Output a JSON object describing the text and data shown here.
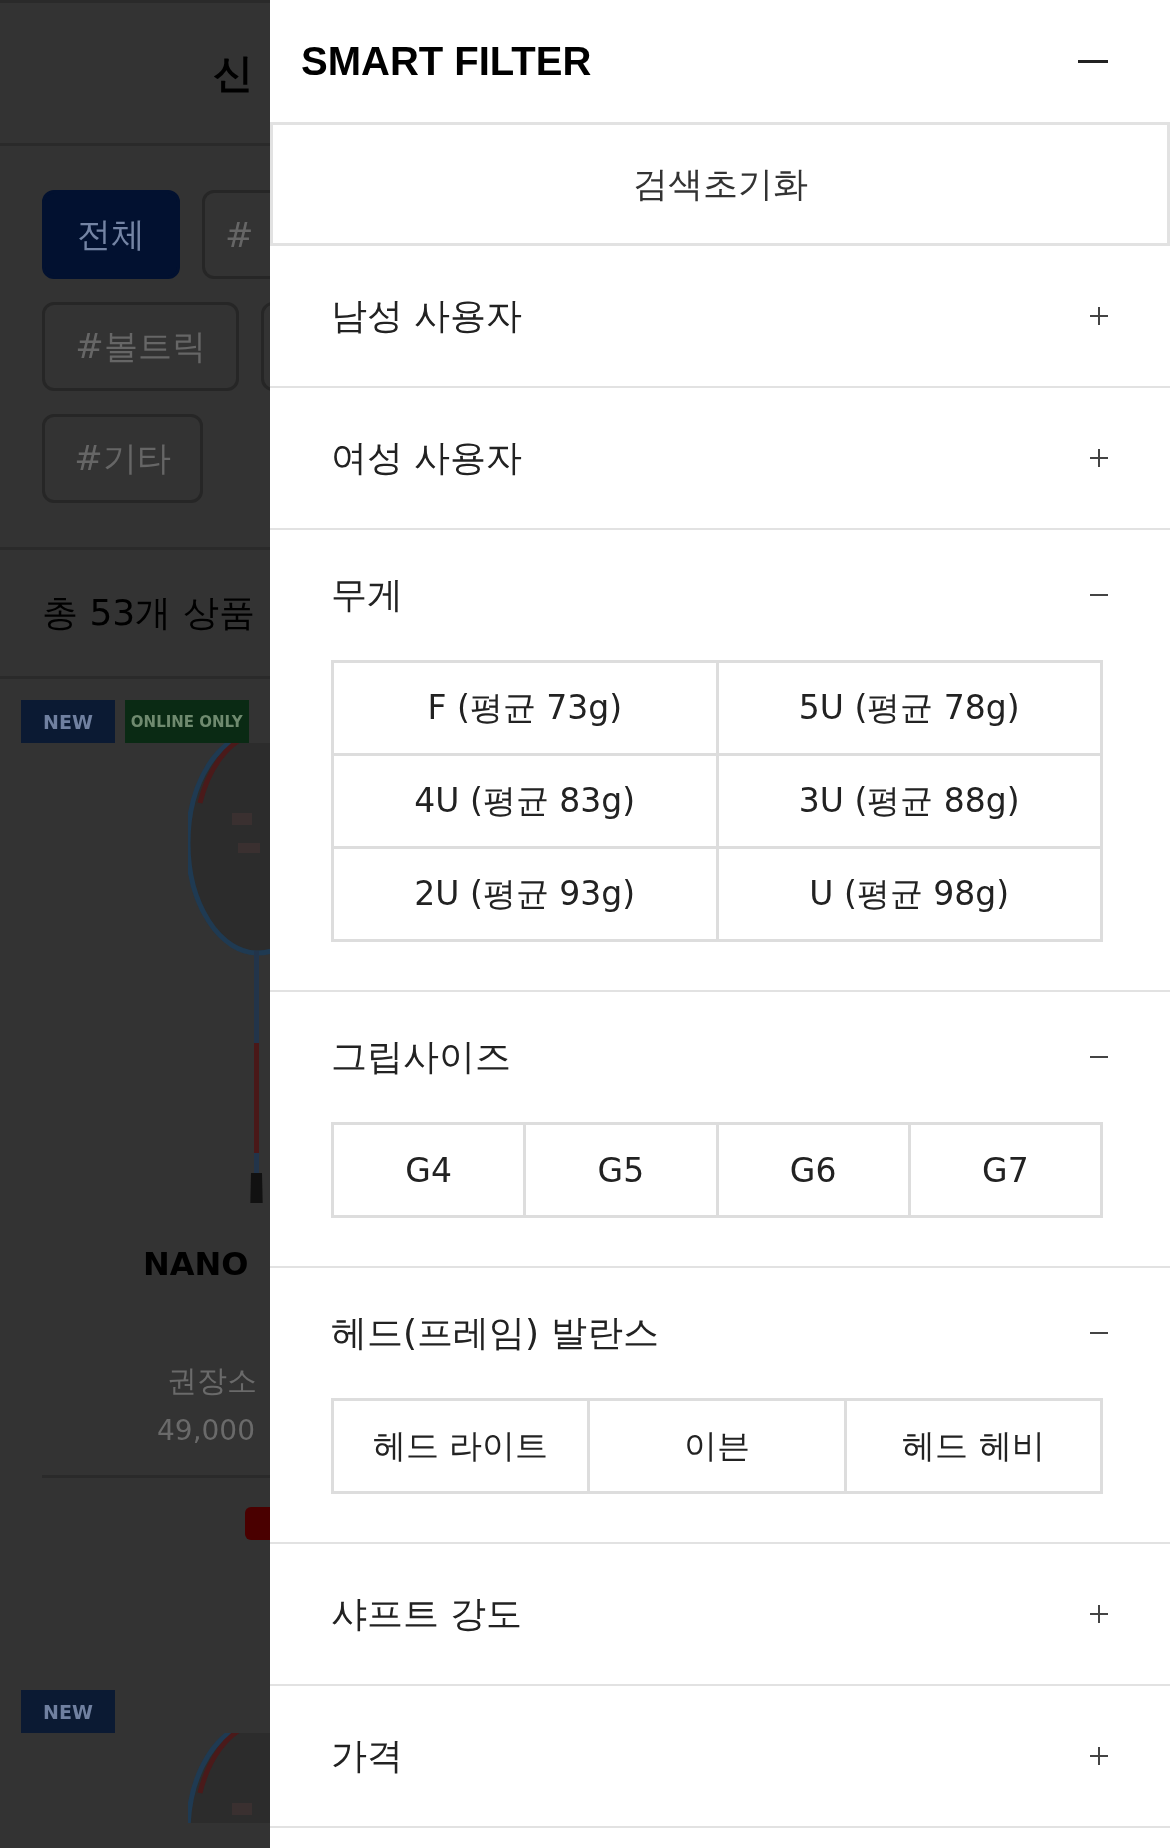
{
  "background_page": {
    "title": "신",
    "chip_rows": [
      [
        {
          "label": "전체",
          "selected": true
        },
        {
          "label": "#",
          "selected": false
        }
      ],
      [
        {
          "label": "#볼트릭",
          "selected": false
        },
        {
          "selected": false
        }
      ],
      [
        {
          "label": "#기타",
          "selected": false
        }
      ]
    ],
    "count": "총 53개 상품",
    "products": [
      {
        "badges": [
          {
            "kind": "new",
            "text": "NEW"
          },
          {
            "kind": "online",
            "text": "ONLINE ONLY"
          }
        ],
        "picture": {
          "kind": "picture"
        },
        "name": "NANO",
        "price_label": "권장소",
        "price": "49,000"
      },
      {
        "badges": [
          {
            "kind": "new",
            "text": "NEW"
          }
        ],
        "picture": {
          "kind": "picture"
        }
      }
    ]
  },
  "filter": {
    "title": "SMART FILTER",
    "expanded": true,
    "reset_button": "검색초기화",
    "sections": [
      {
        "title": "남성 사용자",
        "expanded": false
      },
      {
        "title": "여성 사용자",
        "expanded": false
      },
      {
        "title": "무게",
        "expanded": true,
        "rows": [
          [
            {
              "label": "F (평균 73g)",
              "selected": false
            },
            {
              "label": "5U (평균 78g)",
              "selected": false
            }
          ],
          [
            {
              "label": "4U (평균 83g)",
              "selected": false
            },
            {
              "label": "3U (평균 88g)",
              "selected": false
            }
          ],
          [
            {
              "label": "2U (평균 93g)",
              "selected": false
            },
            {
              "label": "U (평균 98g)",
              "selected": false
            }
          ]
        ]
      },
      {
        "title": "그립사이즈",
        "expanded": true,
        "rows": [
          [
            {
              "label": "G4",
              "selected": false
            },
            {
              "label": "G5",
              "selected": false
            },
            {
              "label": "G6",
              "selected": false
            },
            {
              "label": "G7",
              "selected": false
            }
          ]
        ]
      },
      {
        "title": "헤드(프레임) 발란스",
        "expanded": true,
        "rows": [
          [
            {
              "label": "헤드 라이트",
              "selected": false
            },
            {
              "label": "이븐",
              "selected": false
            },
            {
              "label": "헤드 헤비",
              "selected": false
            }
          ]
        ]
      },
      {
        "title": "샤프트 강도",
        "expanded": false
      },
      {
        "title": "가격",
        "expanded": false
      }
    ]
  }
}
